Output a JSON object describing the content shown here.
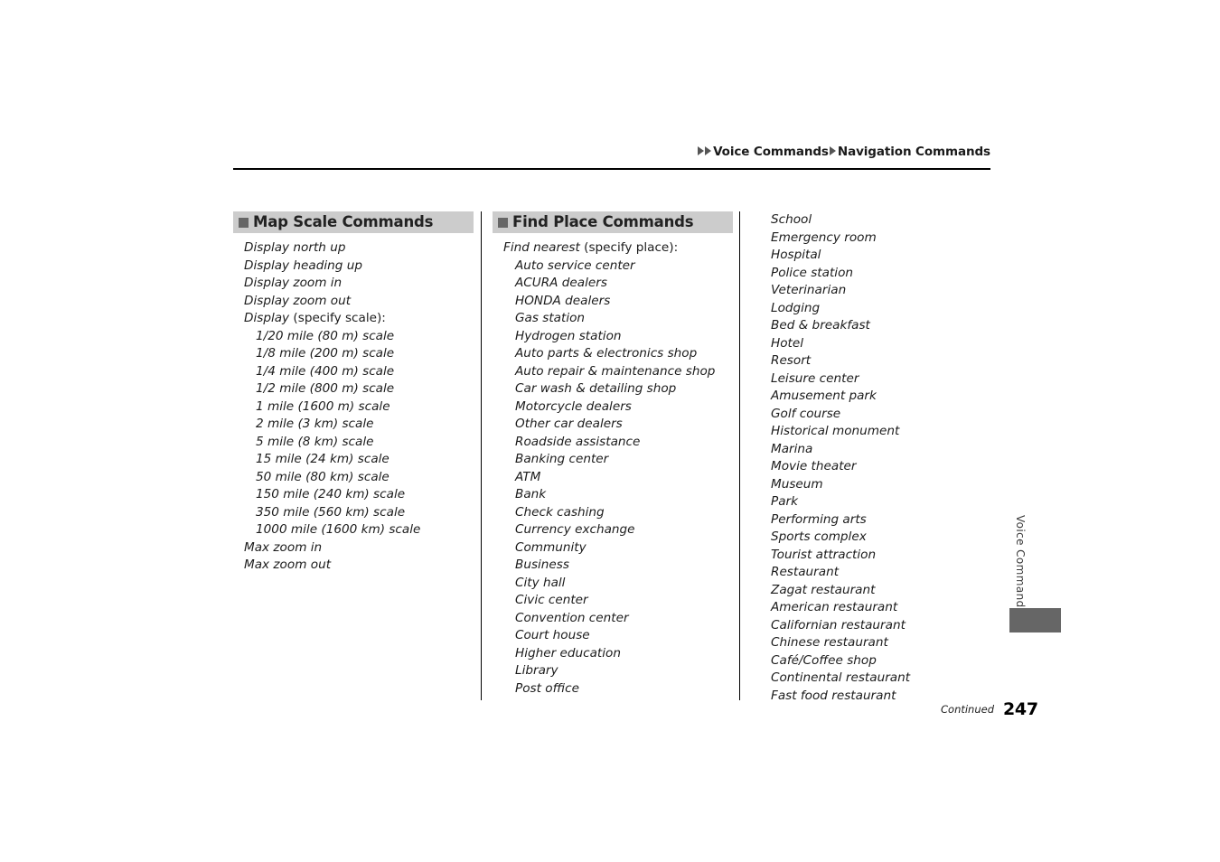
{
  "header": {
    "breadcrumb": [
      "Voice Commands",
      "Navigation Commands"
    ],
    "arrow_icon": "triangle-right-icon"
  },
  "columns": {
    "map_scale": {
      "title": "Map Scale Commands",
      "bullet_icon": "square-bullet-icon",
      "items": [
        {
          "text": "Display north up",
          "level": 0
        },
        {
          "text": "Display heading up",
          "level": 0
        },
        {
          "text": "Display zoom in",
          "level": 0
        },
        {
          "text": "Display zoom out",
          "level": 0
        },
        {
          "text": "Display (specify scale):",
          "level": 0
        },
        {
          "text": "1/20 mile (80 m) scale",
          "level": 1
        },
        {
          "text": "1/8 mile (200 m) scale",
          "level": 1
        },
        {
          "text": "1/4 mile (400 m) scale",
          "level": 1
        },
        {
          "text": "1/2 mile (800 m) scale",
          "level": 1
        },
        {
          "text": "1 mile (1600 m) scale",
          "level": 1
        },
        {
          "text": "2 mile (3 km) scale",
          "level": 1
        },
        {
          "text": "5 mile (8 km) scale",
          "level": 1
        },
        {
          "text": "15 mile (24 km) scale",
          "level": 1
        },
        {
          "text": "50 mile (80 km) scale",
          "level": 1
        },
        {
          "text": "150 mile (240 km) scale",
          "level": 1
        },
        {
          "text": "350 mile (560 km) scale",
          "level": 1
        },
        {
          "text": "1000 mile (1600 km) scale",
          "level": 1
        },
        {
          "text": "Max zoom in",
          "level": 0
        },
        {
          "text": "Max zoom out",
          "level": 0
        }
      ]
    },
    "find_place": {
      "title": "Find Place Commands",
      "bullet_icon": "square-bullet-icon",
      "items": [
        {
          "text": "Find nearest (specify place):",
          "level": 0
        },
        {
          "text": "Auto service center",
          "level": 1
        },
        {
          "text": "ACURA dealers",
          "level": 1
        },
        {
          "text": "HONDA dealers",
          "level": 1
        },
        {
          "text": "Gas station",
          "level": 1
        },
        {
          "text": "Hydrogen station",
          "level": 1
        },
        {
          "text": "Auto parts & electronics shop",
          "level": 1
        },
        {
          "text": "Auto repair & maintenance shop",
          "level": 1
        },
        {
          "text": "Car wash & detailing shop",
          "level": 1
        },
        {
          "text": "Motorcycle dealers",
          "level": 1
        },
        {
          "text": "Other car dealers",
          "level": 1
        },
        {
          "text": "Roadside assistance",
          "level": 1
        },
        {
          "text": "Banking center",
          "level": 1
        },
        {
          "text": "ATM",
          "level": 1
        },
        {
          "text": "Bank",
          "level": 1
        },
        {
          "text": "Check cashing",
          "level": 1
        },
        {
          "text": "Currency exchange",
          "level": 1
        },
        {
          "text": "Community",
          "level": 1
        },
        {
          "text": "Business",
          "level": 1
        },
        {
          "text": "City hall",
          "level": 1
        },
        {
          "text": "Civic center",
          "level": 1
        },
        {
          "text": "Convention center",
          "level": 1
        },
        {
          "text": "Court house",
          "level": 1
        },
        {
          "text": "Higher education",
          "level": 1
        },
        {
          "text": "Library",
          "level": 1
        },
        {
          "text": "Post office",
          "level": 1
        }
      ]
    },
    "find_place_continued": {
      "items": [
        {
          "text": "School",
          "level": 0
        },
        {
          "text": "Emergency room",
          "level": 0
        },
        {
          "text": "Hospital",
          "level": 0
        },
        {
          "text": "Police station",
          "level": 0
        },
        {
          "text": "Veterinarian",
          "level": 0
        },
        {
          "text": "Lodging",
          "level": 0
        },
        {
          "text": "Bed & breakfast",
          "level": 0
        },
        {
          "text": "Hotel",
          "level": 0
        },
        {
          "text": "Resort",
          "level": 0
        },
        {
          "text": "Leisure center",
          "level": 0
        },
        {
          "text": "Amusement park",
          "level": 0
        },
        {
          "text": "Golf course",
          "level": 0
        },
        {
          "text": "Historical monument",
          "level": 0
        },
        {
          "text": "Marina",
          "level": 0
        },
        {
          "text": "Movie theater",
          "level": 0
        },
        {
          "text": "Museum",
          "level": 0
        },
        {
          "text": "Park",
          "level": 0
        },
        {
          "text": "Performing arts",
          "level": 0
        },
        {
          "text": "Sports complex",
          "level": 0
        },
        {
          "text": "Tourist attraction",
          "level": 0
        },
        {
          "text": "Restaurant",
          "level": 0
        },
        {
          "text": "Zagat restaurant",
          "level": 0
        },
        {
          "text": "American restaurant",
          "level": 0
        },
        {
          "text": "Californian restaurant",
          "level": 0
        },
        {
          "text": "Chinese restaurant",
          "level": 0
        },
        {
          "text": "Café/Coffee shop",
          "level": 0
        },
        {
          "text": "Continental restaurant",
          "level": 0
        },
        {
          "text": "Fast food restaurant",
          "level": 0
        }
      ]
    }
  },
  "side_tab": {
    "label": "Voice Commands"
  },
  "footer": {
    "continued": "Continued",
    "page_number": "247"
  },
  "colors": {
    "section_band": "#cccccc",
    "bullet": "#666666",
    "side_marker": "#666666",
    "rule": "#000000"
  }
}
